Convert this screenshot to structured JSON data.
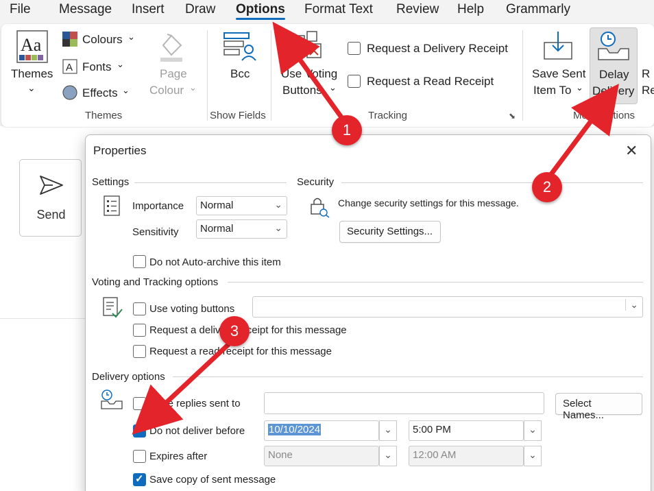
{
  "menu": {
    "items": [
      "File",
      "Message",
      "Insert",
      "Draw",
      "Options",
      "Format Text",
      "Review",
      "Help",
      "Grammarly"
    ],
    "active": "Options"
  },
  "ribbon": {
    "themes": {
      "themes_label": "Themes",
      "colours_label": "Colours",
      "fonts_label": "Fonts",
      "effects_label": "Effects",
      "page_colour_line1": "Page",
      "page_colour_line2": "Colour",
      "group_label": "Themes"
    },
    "show_fields": {
      "bcc_label": "Bcc",
      "group_label": "Show Fields"
    },
    "tracking": {
      "use_voting_line1": "Use Voting",
      "use_voting_line2": "Buttons",
      "delivery_receipt_label": "Request a Delivery Receipt",
      "read_receipt_label": "Request a Read Receipt",
      "group_label": "Tracking"
    },
    "more_options": {
      "save_sent_line1": "Save Sent",
      "save_sent_line2": "Item To",
      "delay_line1": "Delay",
      "delay_line2": "Delivery",
      "group_label": "More Options"
    }
  },
  "compose": {
    "send_label": "Send"
  },
  "dialog": {
    "title": "Properties",
    "settings": {
      "heading": "Settings",
      "importance_label": "Importance",
      "importance_value": "Normal",
      "sensitivity_label": "Sensitivity",
      "sensitivity_value": "Normal",
      "auto_archive_label": "Do not Auto-archive this item",
      "auto_archive_checked": false
    },
    "security": {
      "heading": "Security",
      "description": "Change security settings for this message.",
      "button_label": "Security Settings..."
    },
    "voting": {
      "heading": "Voting and Tracking options",
      "use_voting_label": "Use voting buttons",
      "use_voting_value": "",
      "delivery_receipt_label": "Request a delivery receipt for this message",
      "read_receipt_label": "Request a read receipt for this message"
    },
    "delivery": {
      "heading": "Delivery options",
      "have_replies_label": "Have replies sent to",
      "have_replies_value": "",
      "select_names_label": "Select Names...",
      "do_not_deliver_label": "Do not deliver before",
      "do_not_deliver_checked": true,
      "deliver_date": "10/10/2024",
      "deliver_time": "5:00 PM",
      "expires_label": "Expires after",
      "expires_checked": false,
      "expires_date": "None",
      "expires_time": "12:00 AM",
      "save_copy_label": "Save copy of sent message",
      "save_copy_checked": true
    }
  },
  "annotations": {
    "badge_1": "1",
    "badge_2": "2",
    "badge_3": "3",
    "arrow_color": "#e3242b"
  },
  "colors": {
    "accent": "#0f6cbd",
    "annotation_red": "#e3242b"
  }
}
